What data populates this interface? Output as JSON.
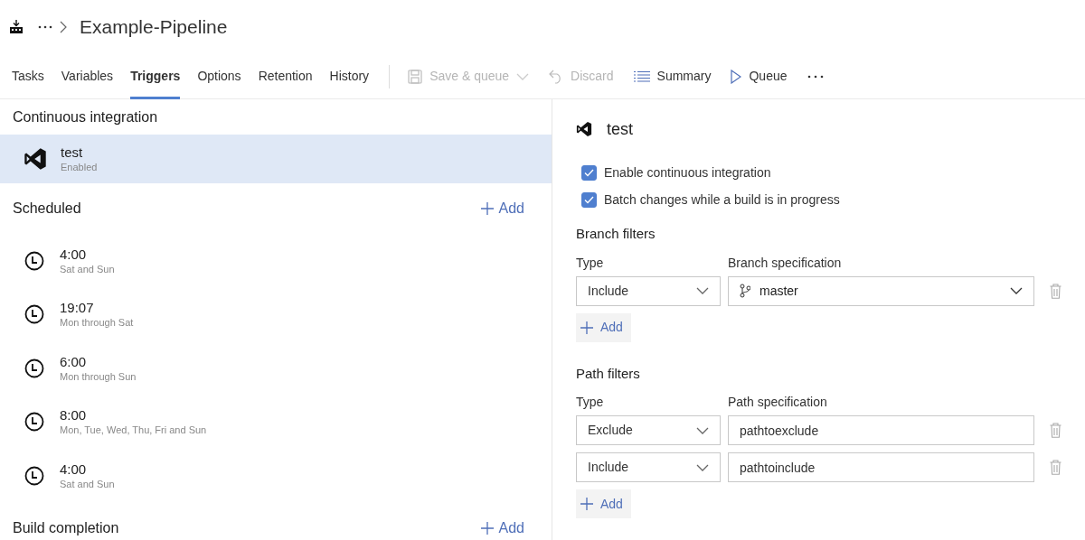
{
  "header": {
    "title": "Example-Pipeline"
  },
  "tabs": [
    {
      "label": "Tasks",
      "selected": false
    },
    {
      "label": "Variables",
      "selected": false
    },
    {
      "label": "Triggers",
      "selected": true
    },
    {
      "label": "Options",
      "selected": false
    },
    {
      "label": "Retention",
      "selected": false
    },
    {
      "label": "History",
      "selected": false
    }
  ],
  "toolbar": [
    {
      "kind": "save",
      "label": "Save & queue",
      "disabled": true
    },
    {
      "kind": "discard",
      "label": "Discard",
      "disabled": true
    },
    {
      "kind": "summary",
      "label": "Summary",
      "disabled": false
    },
    {
      "kind": "queue",
      "label": "Queue",
      "disabled": false
    },
    {
      "kind": "more"
    }
  ],
  "continuous_integration": {
    "heading": "Continuous integration",
    "items": [
      {
        "name": "test",
        "status": "Enabled",
        "selected": true
      }
    ]
  },
  "scheduled": {
    "heading": "Scheduled",
    "add_label": "Add",
    "items": [
      {
        "time": "4:00",
        "days": "Sat and Sun"
      },
      {
        "time": "19:07",
        "days": "Mon through Sat"
      },
      {
        "time": "6:00",
        "days": "Mon through Sun"
      },
      {
        "time": "8:00",
        "days": "Mon, Tue, Wed, Thu, Fri and Sun"
      },
      {
        "time": "4:00",
        "days": "Sat and Sun"
      }
    ]
  },
  "build_completion": {
    "heading": "Build completion",
    "add_label": "Add"
  },
  "details": {
    "title": "test",
    "options": [
      {
        "label": "Enable continuous integration",
        "checked": true
      },
      {
        "label": "Batch changes while a build is in progress",
        "checked": true
      }
    ],
    "branch_filters": {
      "heading": "Branch filters",
      "type_label": "Type",
      "spec_label": "Branch specification",
      "add_label": "Add",
      "rows": [
        {
          "type": "Include",
          "spec": "master"
        }
      ]
    },
    "path_filters": {
      "heading": "Path filters",
      "type_label": "Type",
      "spec_label": "Path specification",
      "add_label": "Add",
      "rows": [
        {
          "type": "Exclude",
          "spec": "pathtoexclude"
        },
        {
          "type": "Include",
          "spec": "pathtoinclude"
        }
      ]
    }
  }
}
